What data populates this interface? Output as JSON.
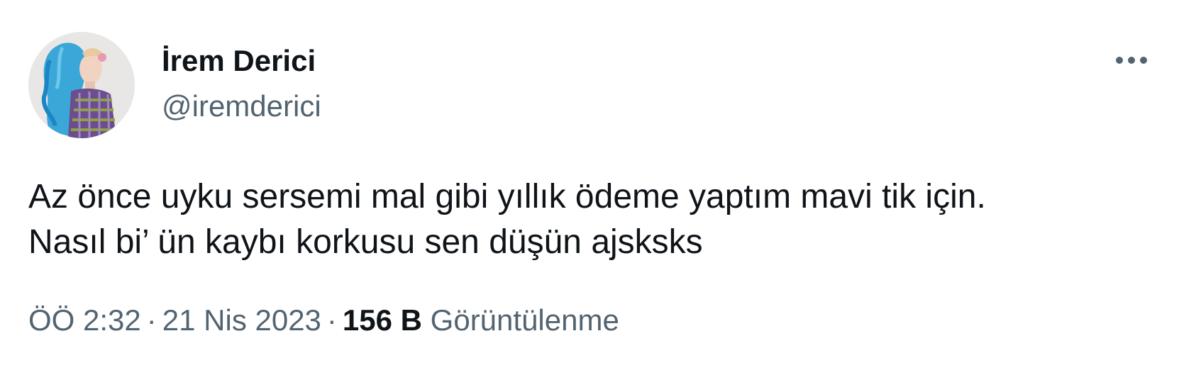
{
  "author": {
    "display_name": "İrem Derici",
    "handle": "@iremderici",
    "avatar_icon": "profile-photo"
  },
  "more_icon": "more-horizontal-icon",
  "tweet": {
    "text": "Az önce uyku sersemi mal gibi yıllık ödeme yaptım mavi tik için.\nNasıl bi’ ün kaybı korkusu sen düşün ajsksks"
  },
  "meta": {
    "time": "ÖÖ 2:32",
    "separator": "·",
    "date": "21 Nis 2023",
    "views_count": "156 B",
    "views_label": "Görüntülenme"
  },
  "colors": {
    "primary_text": "#0f1419",
    "secondary_text": "#536471",
    "background": "#ffffff"
  }
}
